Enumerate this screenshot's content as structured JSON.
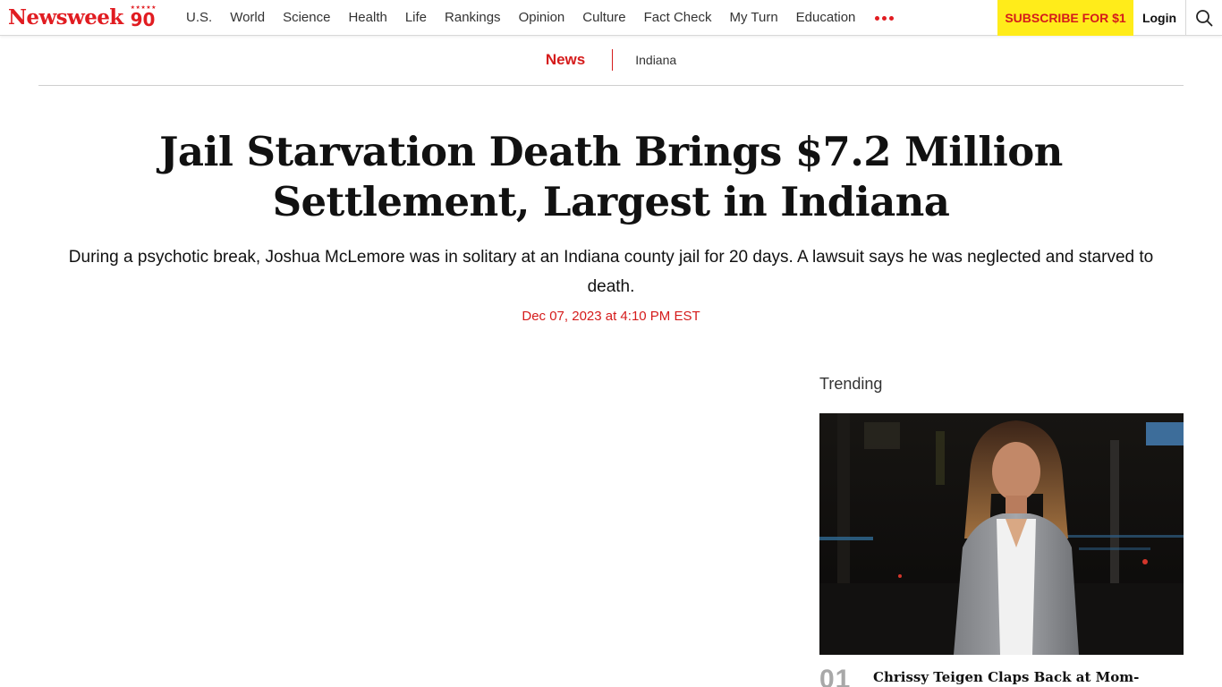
{
  "brand": {
    "name": "Newsweek",
    "badge_stars": "★★★★★",
    "badge_number": "90",
    "accent_color": "#e11c21"
  },
  "nav": {
    "links": [
      {
        "label": "U.S."
      },
      {
        "label": "World"
      },
      {
        "label": "Science"
      },
      {
        "label": "Health"
      },
      {
        "label": "Life"
      },
      {
        "label": "Rankings"
      },
      {
        "label": "Opinion"
      },
      {
        "label": "Culture"
      },
      {
        "label": "Fact Check"
      },
      {
        "label": "My Turn"
      },
      {
        "label": "Education"
      }
    ],
    "more_icon": "more-dots-icon",
    "subscribe_label": "SUBSCRIBE FOR $1",
    "subscribe_color": "#ffec1a",
    "login_label": "Login",
    "search_icon": "search-icon"
  },
  "breadcrumb": {
    "section": "News",
    "tag": "Indiana"
  },
  "article": {
    "headline": "Jail Starvation Death Brings $7.2 Million Settlement, Largest in Indiana",
    "dek": "During a psychotic break, Joshua McLemore was in solitary at an Indiana county jail for 20 days. A lawsuit says he was neglected and starved to death.",
    "dateline": "Dec 07, 2023 at 4:10 PM EST"
  },
  "trending": {
    "heading": "Trending",
    "items": [
      {
        "rank": "01",
        "title": "Chrissy Teigen Claps Back at Mom-Shamer"
      }
    ]
  }
}
